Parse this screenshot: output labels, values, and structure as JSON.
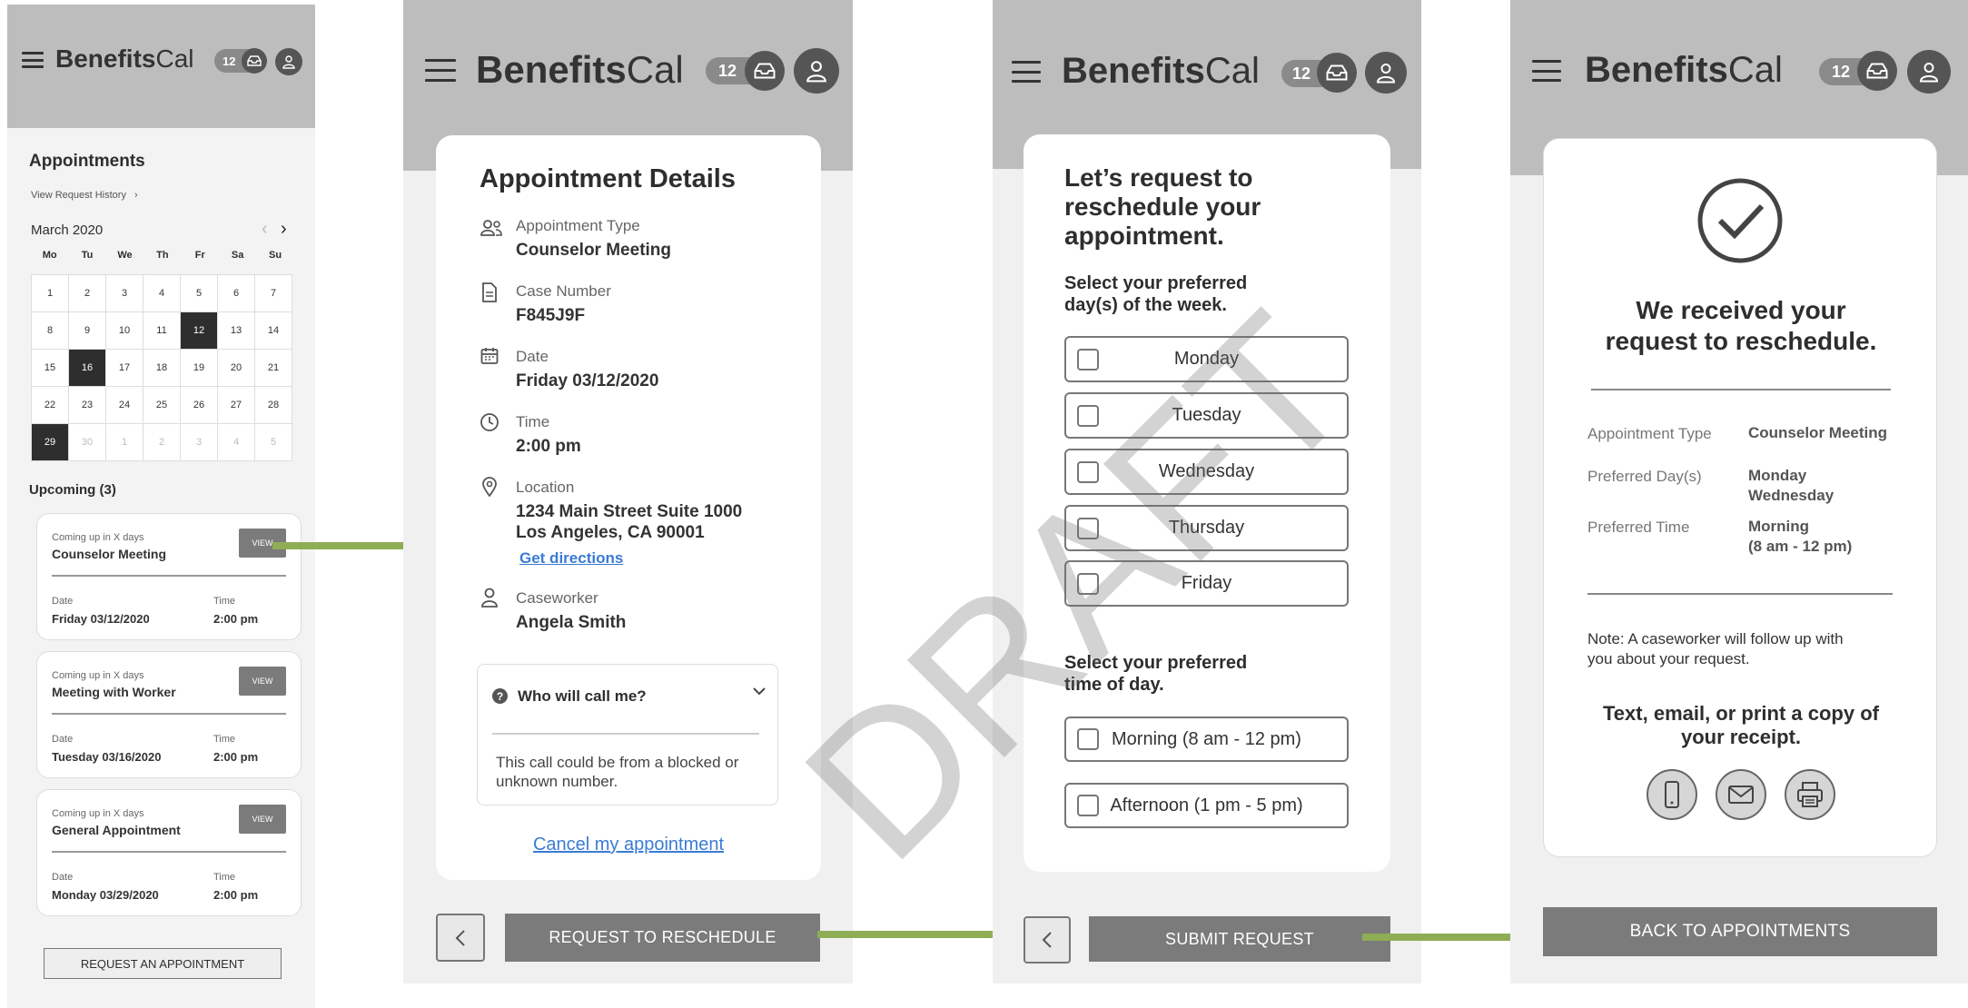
{
  "app": {
    "logo_bold": "Benefits",
    "logo_light": "Cal",
    "notification_count": "12"
  },
  "screen1": {
    "title": "Appointments",
    "history_link": "View Request History",
    "month": "March 2020",
    "weekdays": [
      "Mo",
      "Tu",
      "We",
      "Th",
      "Fr",
      "Sa",
      "Su"
    ],
    "weeks": [
      [
        "1",
        "2",
        "3",
        "4",
        "5",
        "6",
        "7"
      ],
      [
        "8",
        "9",
        "10",
        "11",
        "12",
        "13",
        "14"
      ],
      [
        "15",
        "16",
        "17",
        "18",
        "19",
        "20",
        "21"
      ],
      [
        "22",
        "23",
        "24",
        "25",
        "26",
        "27",
        "28"
      ],
      [
        "29",
        "30",
        "1",
        "2",
        "3",
        "4",
        "5"
      ]
    ],
    "upcoming_title": "Upcoming (3)",
    "cards": [
      {
        "coming": "Coming up in X days",
        "title": "Counselor Meeting",
        "view": "VIEW",
        "date_label": "Date",
        "date": "Friday 03/12/2020",
        "time_label": "Time",
        "time": "2:00 pm"
      },
      {
        "coming": "Coming up in X days",
        "title": "Meeting with Worker",
        "view": "VIEW",
        "date_label": "Date",
        "date": "Tuesday 03/16/2020",
        "time_label": "Time",
        "time": "2:00 pm"
      },
      {
        "coming": "Coming up in X days",
        "title": "General Appointment",
        "view": "VIEW",
        "date_label": "Date",
        "date": "Monday 03/29/2020",
        "time_label": "Time",
        "time": "2:00 pm"
      }
    ],
    "request_button": "REQUEST AN APPOINTMENT"
  },
  "screen2": {
    "title": "Appointment Details",
    "type_label": "Appointment Type",
    "type_value": "Counselor Meeting",
    "case_label": "Case Number",
    "case_value": "F845J9F",
    "date_label": "Date",
    "date_value": "Friday 03/12/2020",
    "time_label": "Time",
    "time_value": "2:00 pm",
    "location_label": "Location",
    "location_line1": "1234 Main Street Suite 1000",
    "location_line2": "Los Angeles, CA 90001",
    "directions_link": "Get directions",
    "caseworker_label": "Caseworker",
    "caseworker_value": "Angela Smith",
    "faq_question": "Who will call me?",
    "faq_answer_line1": "This call could be from a blocked or",
    "faq_answer_line2": "unknown number.",
    "cancel_link": "Cancel my appointment",
    "reschedule_button": "REQUEST TO RESCHEDULE"
  },
  "screen3": {
    "heading_line1": "Let’s request to",
    "heading_line2": "reschedule your",
    "heading_line3": "appointment.",
    "day_prompt_line1": "Select your preferred",
    "day_prompt_line2": "day(s) of the week.",
    "days": [
      "Monday",
      "Tuesday",
      "Wednesday",
      "Thursday",
      "Friday"
    ],
    "time_prompt_line1": "Select your preferred",
    "time_prompt_line2": "time of day.",
    "times": [
      "Morning (8 am - 12 pm)",
      "Afternoon (1 pm - 5 pm)"
    ],
    "submit_button": "SUBMIT REQUEST",
    "watermark": "DRAFT"
  },
  "screen4": {
    "heading_line1": "We received your",
    "heading_line2": "request to reschedule.",
    "type_label": "Appointment Type",
    "type_value": "Counselor Meeting",
    "days_label": "Preferred Day(s)",
    "days_value_line1": "Monday",
    "days_value_line2": "Wednesday",
    "time_label": "Preferred Time",
    "time_value_line1": "Morning",
    "time_value_line2": "(8 am  - 12 pm)",
    "note_line1": "Note: A caseworker will follow up with",
    "note_line2": "you about your request.",
    "receipt_line1": "Text, email, or print a copy of",
    "receipt_line2": "your receipt.",
    "back_button": "BACK TO APPOINTMENTS"
  },
  "colors": {
    "header": "#bdbdbd",
    "button": "#7b7b7b",
    "connector": "#8fad55",
    "link": "#3a7bd5"
  }
}
